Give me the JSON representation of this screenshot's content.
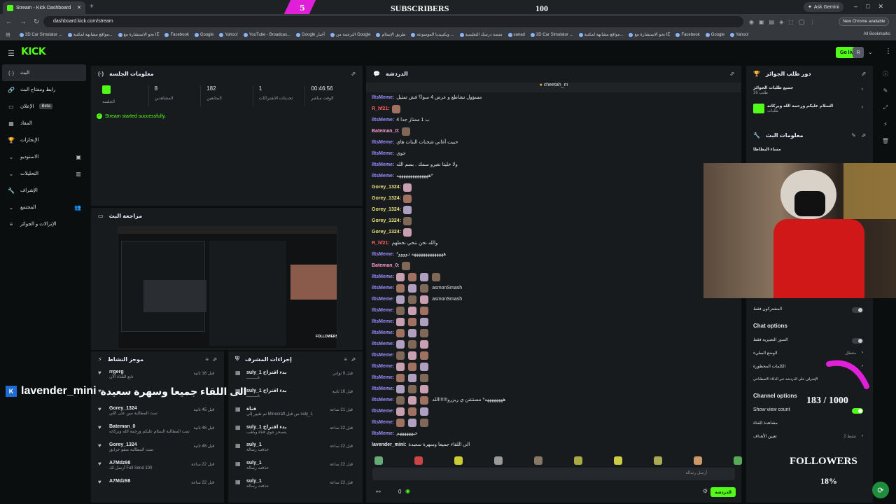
{
  "browser": {
    "tab_title": "Stream - Kick Dashboard",
    "url": "dashboard.kick.com/stream",
    "ask_gemini": "Ask Gemini",
    "new_chrome": "New Chrome available",
    "all_bookmarks": "All Bookmarks",
    "bookmarks": [
      "3D Car Simulator ...",
      "مواقع مشابهة لمكتبة...",
      "نحو الاستشارة مع IE",
      "Facebook",
      "Google",
      "Yahoo!",
      "YouTube - Broadcas...",
      "Google أخبار",
      "الترجمة من Google",
      "طريق الإسلام",
      "ويكيبيديا الموسوعة ...",
      "منصة درسك التعليمية",
      "sanad",
      "3D Car Simulator ...",
      "مواقع مشابهة لمكتبة...",
      "نحو الاستشارة مع IE",
      "Facebook",
      "Google",
      "Yahoo!"
    ]
  },
  "subs_overlay": {
    "count": "5",
    "label": "SUBSCRIBERS",
    "goal": "100"
  },
  "topnav": {
    "logo": "KICK",
    "golive": "Go live",
    "avatar": "R"
  },
  "sidebar": [
    {
      "label": "البث",
      "icon": "(·)"
    },
    {
      "label": "رابط ومفتاح البث",
      "icon": "🔗"
    },
    {
      "label": "الإعلان",
      "icon": "▭",
      "beta": "Beta"
    },
    {
      "label": "المقاد",
      "icon": "▦"
    },
    {
      "label": "الإنجازات",
      "icon": "🏆"
    },
    {
      "label": "الاستوديو",
      "icon": "⌄",
      "rt": "▣"
    },
    {
      "label": "التحليلات",
      "icon": "⌄",
      "rt": "▥"
    },
    {
      "label": "الإشراف",
      "icon": "🔧"
    },
    {
      "label": "المجتمع",
      "icon": "⌄",
      "rt": "👥"
    },
    {
      "label": "الإنزالات و الجوائز",
      "icon": "≡"
    }
  ],
  "session": {
    "title": "معلومات الجلسة",
    "live_label": "الجلسة",
    "stats": [
      {
        "v": "8",
        "l": "المشاهدين"
      },
      {
        "v": "182",
        "l": "المتابعين"
      },
      {
        "v": "1",
        "l": "تحديثات الاشتراكات"
      },
      {
        "v": "00:46:56",
        "l": "الوقت مباشر"
      }
    ],
    "ok": "Stream started successfully."
  },
  "preview": {
    "title": "مراجعة البث"
  },
  "activity": {
    "title": "موجز النشاط",
    "rows": [
      {
        "n": "rrgerg",
        "d": "تابع القناة الآن",
        "t": "قبل 16 ثانية"
      },
      {
        "n": "",
        "d": "",
        "t": ""
      },
      {
        "n": "Gorey_1324",
        "d": "تمت المطالبة مين على اللي",
        "t": "قبل 45 ثانية"
      },
      {
        "n": "Bateman_0",
        "d": "تمت المطالبة السلام عليكم ورحمة الله وبركاته",
        "t": "قبل 46 ثانية"
      },
      {
        "n": "Gorey_1324",
        "d": "تمت المطالبة صفو حرابق",
        "t": "قبل 46 ثانية"
      },
      {
        "n": "A7Mdz98",
        "d": "أرسل لك Full Send 100",
        "t": "قبل 22 ساعة"
      },
      {
        "n": "A7Mdz98",
        "d": "",
        "t": "قبل 22 ساعة"
      }
    ]
  },
  "modactions": {
    "title": "إجراءات المشرف",
    "rows": [
      {
        "n": "suly_1 بدء اقتراح",
        "d": "ةـــــــــ",
        "t": "قبل 9 ثواني"
      },
      {
        "n": "suly_1 بدء اقتراح",
        "d": "ةـــــــــ",
        "t": "قبل 16 ثانية"
      },
      {
        "n": "قناة",
        "d": "تم تغيير إلى Minecraft من قبل suly_1",
        "t": "قبل 21 ساعة"
      },
      {
        "n": "suly_1 بدء اقتراح",
        "d": "يتصحر جوي قناة وبلقب",
        "t": "قبل 22 ساعة"
      },
      {
        "n": "suly_1",
        "d": "حذفت رسالة",
        "t": "قبل 22 ساعة"
      },
      {
        "n": "suly_1",
        "d": "حذفت رسالة",
        "t": "قبل 22 ساعة"
      },
      {
        "n": "suly_1",
        "d": "حذفت رسالة",
        "t": "قبل 22 ساعة"
      }
    ]
  },
  "chat": {
    "title": "الدردشة",
    "pinned": "cheetah_m",
    "placeholder": "أرسل رسالة",
    "send": "الدردشة",
    "footer_count": "0",
    "msgs": [
      {
        "u": "IltsMeme:",
        "c": "#9b8cff",
        "t": "مسؤول نشاطع و عرض 4 سوا؟ فش تمثيل"
      },
      {
        "u": "R_hf21:",
        "c": "#ff5c5c",
        "t": "",
        "e": 1
      },
      {
        "u": "IltsMeme:",
        "c": "#9b8cff",
        "t": "4 ب 1 ممتاز جدا"
      },
      {
        "u": "Bateman_0:",
        "c": "#ff9bd0",
        "t": "",
        "e": 1
      },
      {
        "u": "IltsMeme:",
        "c": "#9b8cff",
        "t": "حبيت أغاني شحنات البنات هاي"
      },
      {
        "u": "IltsMeme:",
        "c": "#9b8cff",
        "t": "جوي"
      },
      {
        "u": "IltsMeme:",
        "c": "#9b8cff",
        "t": "ولا خليتا نغيرو سمك . بسم الله"
      },
      {
        "u": "IltsMeme:",
        "c": "#9b8cff",
        "t": "ههههههههههههههه*"
      },
      {
        "u": "Gorey_1324:",
        "c": "#e8e27a",
        "t": "",
        "e": 1
      },
      {
        "u": "Gorey_1324:",
        "c": "#e8e27a",
        "t": "",
        "e": 1
      },
      {
        "u": "Gorey_1324:",
        "c": "#e8e27a",
        "t": "",
        "e": 1
      },
      {
        "u": "Gorey_1324:",
        "c": "#e8e27a",
        "t": "",
        "e": 1
      },
      {
        "u": "Gorey_1324:",
        "c": "#e8e27a",
        "t": "",
        "e": 1
      },
      {
        "u": "R_hf21:",
        "c": "#ff5c5c",
        "t": "والله نحن ننحي نحطهم"
      },
      {
        "u": "IltsMeme:",
        "c": "#9b8cff",
        "t": "*ههههههههههههههه دوووو"
      },
      {
        "u": "Bateman_0:",
        "c": "#ff9bd0",
        "t": "",
        "e": 1
      },
      {
        "u": "IltsMeme:",
        "c": "#9b8cff",
        "t": "",
        "e": 4
      },
      {
        "u": "IltsMeme:",
        "c": "#9b8cff",
        "t": "asmonSmash",
        "e": 3
      },
      {
        "u": "IltsMeme:",
        "c": "#9b8cff",
        "t": "asmonSmash",
        "e": 3
      },
      {
        "u": "IltsMeme:",
        "c": "#9b8cff",
        "t": "",
        "e": 3
      },
      {
        "u": "IltsMeme:",
        "c": "#9b8cff",
        "t": "",
        "e": 3
      },
      {
        "u": "IltsMeme:",
        "c": "#9b8cff",
        "t": "",
        "e": 3
      },
      {
        "u": "IltsMeme:",
        "c": "#9b8cff",
        "t": "",
        "e": 3
      },
      {
        "u": "IltsMeme:",
        "c": "#9b8cff",
        "t": "",
        "e": 3
      },
      {
        "u": "IltsMeme:",
        "c": "#9b8cff",
        "t": "",
        "e": 3
      },
      {
        "u": "IltsMeme:",
        "c": "#9b8cff",
        "t": "",
        "e": 3
      },
      {
        "u": "IltsMeme:",
        "c": "#9b8cff",
        "t": "",
        "e": 3
      },
      {
        "u": "IltsMeme:",
        "c": "#9b8cff",
        "t": "ههههههههه* مستتقن ي ربزرو!!!!!!الله",
        "e": 3
      },
      {
        "u": "IltsMeme:",
        "c": "#9b8cff",
        "t": "",
        "e": 3
      },
      {
        "u": "IltsMeme:",
        "c": "#9b8cff",
        "t": "",
        "e": 3
      },
      {
        "u": "IltsMeme:",
        "c": "#9b8cff",
        "t": "جيههههههم"
      },
      {
        "u": "lavender_mini:",
        "c": "#e8eaed",
        "t": "الى اللقاء جميعا وسهرة سعيدة"
      }
    ]
  },
  "rewards": {
    "title": "دور طلب الجوائز",
    "r1": "جميع طلبات الجوائز",
    "r1s": "16 طلب",
    "r2": "السلام عليكم ورحمة الله وبركاته",
    "r2s": "طلبات"
  },
  "streaminfo": {
    "title": "معلومات البث",
    "name": "مساء البطاطا"
  },
  "chatopts": {
    "subonly": "المشتركون فقط",
    "h1": "Chat options",
    "emoteonly": "الصور التعبيرية فقط",
    "slow": "الوضع البطيء",
    "slowv": "معطل",
    "banned": "الكلمات المحظورة",
    "ai": "الإشراف على الدردشة عبر الذكاء الاصطناعي",
    "h2": "Channel options",
    "viewcount": "Show view count",
    "share": "مشاهدة القناة",
    "goals": "تعيين الأهداف",
    "goalsv": "نشط 2"
  },
  "stream_overlay": {
    "name": "lavender_mini",
    "msg": "الى اللقاء جميعا وسهرة سعيدة",
    "followers_progress": "183 / 1000",
    "followers_label": "FOLLOWERS",
    "followers_pct": "18%"
  }
}
